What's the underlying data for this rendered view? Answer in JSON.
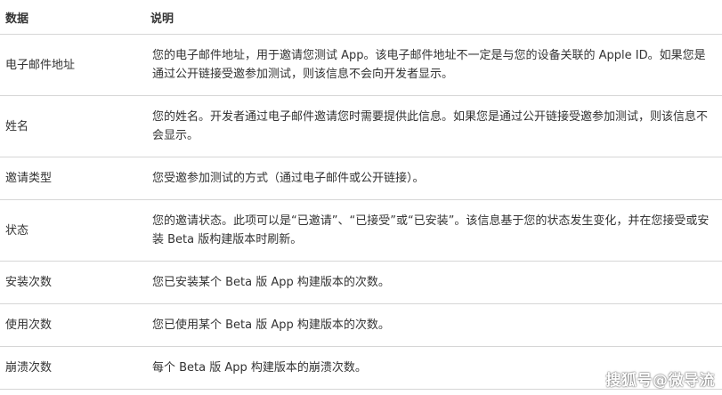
{
  "table": {
    "headers": [
      "数据",
      "说明"
    ],
    "rows": [
      {
        "key": "电子邮件地址",
        "desc": "您的电子邮件地址，用于邀请您测试 App。该电子邮件地址不一定是与您的设备关联的 Apple ID。如果您是通过公开链接受邀参加测试，则该信息不会向开发者显示。"
      },
      {
        "key": "姓名",
        "desc": "您的姓名。开发者通过电子邮件邀请您时需要提供此信息。如果您是通过公开链接受邀参加测试，则该信息不会显示。"
      },
      {
        "key": "邀请类型",
        "desc": "您受邀参加测试的方式（通过电子邮件或公开链接）。"
      },
      {
        "key": "状态",
        "desc": "您的邀请状态。此项可以是“已邀请”、“已接受”或“已安装”。该信息基于您的状态发生变化，并在您接受或安装 Beta 版构建版本时刷新。"
      },
      {
        "key": "安装次数",
        "desc": "您已安装某个 Beta 版 App 构建版本的次数。"
      },
      {
        "key": "使用次数",
        "desc": "您已使用某个 Beta 版 App 构建版本的次数。"
      },
      {
        "key": "崩溃次数",
        "desc": "每个 Beta 版 App 构建版本的崩溃次数。"
      }
    ]
  },
  "watermark": "搜狐号@微导流"
}
